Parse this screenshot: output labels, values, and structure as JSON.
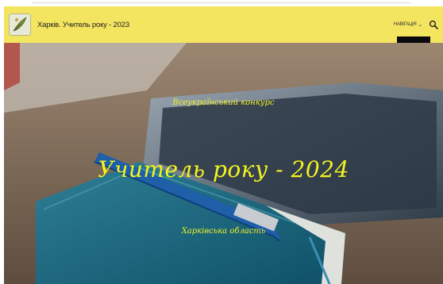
{
  "header": {
    "site_title": "Харків. Учитель року - 2023",
    "menu_label": "НАВІГАЦІЯ",
    "logo_icon": "quill-logo-icon",
    "search_icon": "search-icon",
    "menu_icon": "chevron-down-icon"
  },
  "hero": {
    "subtitle_top": "Всеукраїнський конкурс",
    "title": "Учитель року - 2024",
    "subtitle_bottom": "Харківська область"
  },
  "colors": {
    "header_bg": "#f4e560",
    "hero_text": "#f4f41e"
  }
}
